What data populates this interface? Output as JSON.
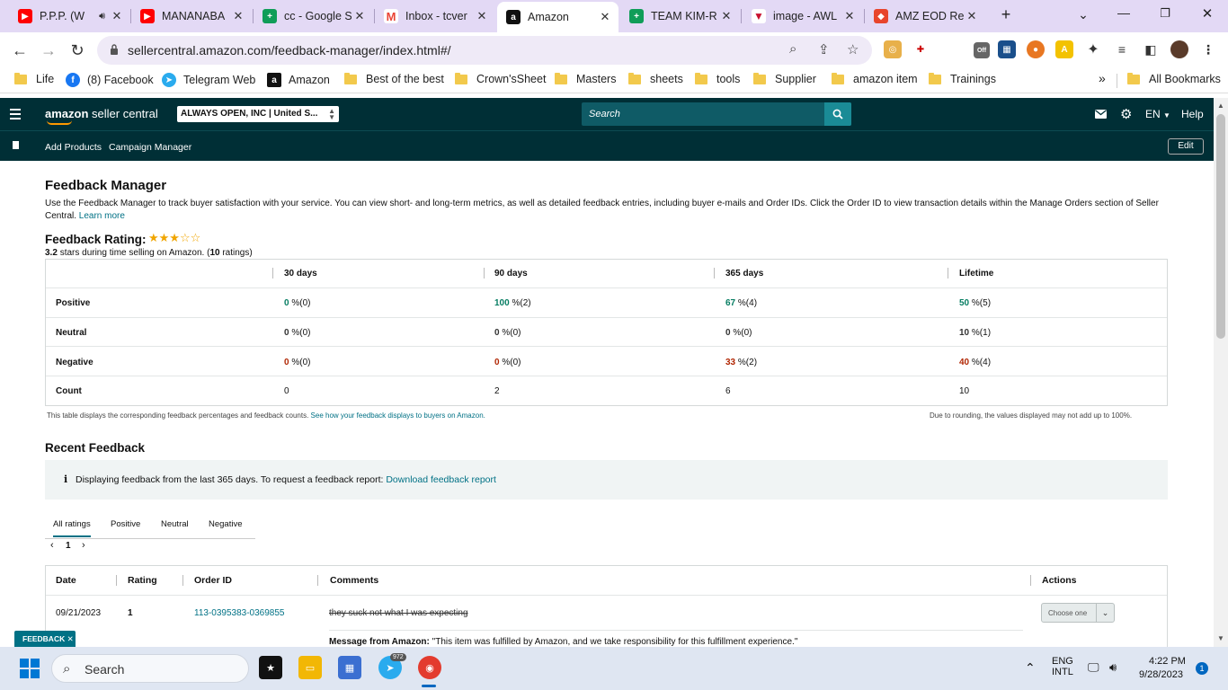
{
  "browser": {
    "tabs": [
      {
        "title": "P.P.P. (W",
        "icon": "youtube-icon",
        "color": "#ff0000"
      },
      {
        "title": "MANANABA",
        "icon": "youtube-icon",
        "color": "#ff0000"
      },
      {
        "title": "cc - Google S",
        "icon": "google-sheets-icon",
        "color": "#0f9d58"
      },
      {
        "title": "Inbox - tcver",
        "icon": "gmail-icon",
        "color": "#ea4335"
      },
      {
        "title": "Amazon",
        "icon": "amazon-icon",
        "color": "#111111"
      },
      {
        "title": "TEAM KIM-R",
        "icon": "google-sheets-icon",
        "color": "#0f9d58"
      },
      {
        "title": "image - AWL",
        "icon": "awl-icon",
        "color": "#c8102e"
      },
      {
        "title": "AMZ EOD Re",
        "icon": "app-icon",
        "color": "#e8452c"
      }
    ],
    "url": "sellercentral.amazon.com/feedback-manager/index.html#/",
    "bookmarks": [
      "Life",
      "(8) Facebook",
      "Telegram Web",
      "Amazon",
      "Best of the best",
      "Crown'sSheet",
      "Masters",
      "sheets",
      "tools",
      "Supplier",
      "amazon item",
      "Trainings",
      "All Bookmarks"
    ],
    "ext_badge": "Off"
  },
  "header": {
    "logo_brand": "amazon",
    "logo_text": "seller central",
    "account": "ALWAYS OPEN, INC | United S...",
    "search_placeholder": "Search",
    "language": "EN",
    "help": "Help",
    "nav": [
      "Add Products",
      "Campaign Manager"
    ],
    "edit": "Edit"
  },
  "page": {
    "title": "Feedback Manager",
    "description": "Use the Feedback Manager to track buyer satisfaction with your service. You can view short- and long-term metrics, as well as detailed feedback entries, including buyer e-mails and Order IDs. Click the Order ID to view transaction details within the Manage Orders section of Seller Central.",
    "learn_more": "Learn more",
    "rating_label": "Feedback Rating:",
    "stars": "★★★☆☆",
    "star_rating": 3,
    "rating_value": "3.2",
    "rating_text_a": "stars during time selling on Amazon. (",
    "rating_count": "10",
    "rating_text_b": "ratings)"
  },
  "metrics": {
    "columns": [
      "30 days",
      "90 days",
      "365 days",
      "Lifetime"
    ],
    "rows": [
      {
        "label": "Positive",
        "cells": [
          {
            "pct": "0",
            "rest": "%(0)"
          },
          {
            "pct": "100",
            "rest": "%(2)"
          },
          {
            "pct": "67",
            "rest": "%(4)"
          },
          {
            "pct": "50",
            "rest": "%(5)"
          }
        ]
      },
      {
        "label": "Neutral",
        "cells": [
          {
            "pct": "0",
            "rest": "%(0)"
          },
          {
            "pct": "0",
            "rest": "%(0)"
          },
          {
            "pct": "0",
            "rest": "%(0)"
          },
          {
            "pct": "10",
            "rest": "%(1)"
          }
        ]
      },
      {
        "label": "Negative",
        "cells": [
          {
            "pct": "0",
            "rest": "%(0)"
          },
          {
            "pct": "0",
            "rest": "%(0)"
          },
          {
            "pct": "33",
            "rest": "%(2)"
          },
          {
            "pct": "40",
            "rest": "%(4)"
          }
        ]
      },
      {
        "label": "Count",
        "cells": [
          {
            "pct": "0",
            "rest": ""
          },
          {
            "pct": "2",
            "rest": ""
          },
          {
            "pct": "6",
            "rest": ""
          },
          {
            "pct": "10",
            "rest": ""
          }
        ]
      }
    ],
    "note_left": "This table displays the corresponding feedback percentages and feedback counts.",
    "note_link": "See how your feedback displays to buyers on Amazon.",
    "note_right": "Due to rounding, the values displayed may not add up to 100%."
  },
  "recent": {
    "title": "Recent Feedback",
    "info_text": "Displaying feedback from the last 365 days. To request a feedback report:",
    "info_link": "Download feedback report",
    "tabs": [
      "All ratings",
      "Positive",
      "Neutral",
      "Negative"
    ],
    "page": "1",
    "columns": [
      "Date",
      "Rating",
      "Order ID",
      "Comments",
      "Actions"
    ],
    "rows": [
      {
        "date": "09/21/2023",
        "rating": "1",
        "order_id": "113-0395383-0369855",
        "comment": "they suck not what I was expecting",
        "message_label": "Message from Amazon:",
        "message": "\"This item was fulfilled by Amazon, and we take responsibility for this fulfillment experience.\"",
        "action": "Choose one"
      }
    ],
    "feedback_btn": "FEEDBACK"
  },
  "taskbar": {
    "search": "Search",
    "telegram_badge": "972",
    "lang1": "ENG",
    "lang2": "INTL",
    "time": "4:22 PM",
    "date": "9/28/2023",
    "notif": "1"
  },
  "colors": {
    "header": "#002f36",
    "link": "#007185",
    "positive": "#067d62",
    "negative": "#b12704"
  }
}
